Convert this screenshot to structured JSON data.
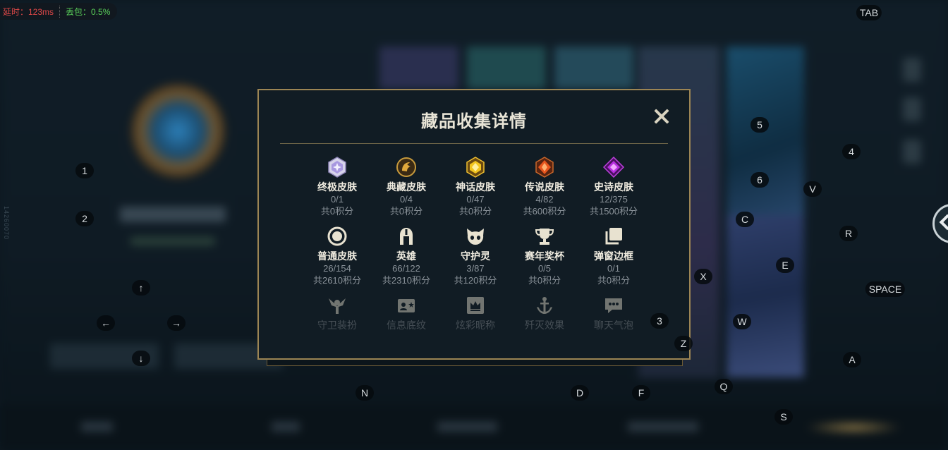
{
  "network": {
    "latency": "延时：123ms",
    "packet_loss": "丢包：0.5%"
  },
  "side_id": "14260070",
  "key_hints": [
    {
      "key": "TAB"
    },
    {
      "key": "1"
    },
    {
      "key": "2"
    },
    {
      "key": "3"
    },
    {
      "key": "4"
    },
    {
      "key": "5"
    },
    {
      "key": "6"
    },
    {
      "key": "V"
    },
    {
      "key": "C"
    },
    {
      "key": "R"
    },
    {
      "key": "E"
    },
    {
      "key": "X"
    },
    {
      "key": "SPACE"
    },
    {
      "key": "W"
    },
    {
      "key": "Z"
    },
    {
      "key": "A"
    },
    {
      "key": "Q"
    },
    {
      "key": "N"
    },
    {
      "key": "D"
    },
    {
      "key": "F"
    },
    {
      "key": "S"
    },
    {
      "key": "↑"
    },
    {
      "key": "←"
    },
    {
      "key": "→"
    },
    {
      "key": "↓"
    }
  ],
  "modal": {
    "title": "藏品收集详情",
    "rows": [
      [
        {
          "icon": "ultimate-skin-icon",
          "name": "终极皮肤",
          "count": "0/1",
          "points": "共0积分"
        },
        {
          "icon": "classic-skin-icon",
          "name": "典藏皮肤",
          "count": "0/4",
          "points": "共0积分"
        },
        {
          "icon": "mythic-skin-icon",
          "name": "神话皮肤",
          "count": "0/47",
          "points": "共0积分"
        },
        {
          "icon": "legendary-skin-icon",
          "name": "传说皮肤",
          "count": "4/82",
          "points": "共600积分"
        },
        {
          "icon": "epic-skin-icon",
          "name": "史诗皮肤",
          "count": "12/375",
          "points": "共1500积分"
        }
      ],
      [
        {
          "icon": "normal-skin-icon",
          "name": "普通皮肤",
          "count": "26/154",
          "points": "共2610积分"
        },
        {
          "icon": "champion-helmet-icon",
          "name": "英雄",
          "count": "66/122",
          "points": "共2310积分"
        },
        {
          "icon": "guardian-spirit-icon",
          "name": "守护灵",
          "count": "3/87",
          "points": "共120积分"
        },
        {
          "icon": "trophy-icon",
          "name": "赛年奖杯",
          "count": "0/5",
          "points": "共0积分"
        },
        {
          "icon": "popup-frame-icon",
          "name": "弹窗边框",
          "count": "0/1",
          "points": "共0积分"
        }
      ],
      [
        {
          "icon": "ward-skin-icon",
          "name": "守卫装扮"
        },
        {
          "icon": "info-card-icon",
          "name": "信息底纹"
        },
        {
          "icon": "colorful-name-icon",
          "name": "炫彩昵称"
        },
        {
          "icon": "kill-effect-icon",
          "name": "歼灭效果"
        },
        {
          "icon": "chat-bubble-icon",
          "name": "聊天气泡"
        }
      ]
    ]
  },
  "colors": {
    "modal_border": "#9c8554",
    "modal_bg": "#111c24",
    "latency_red": "#e04848",
    "loss_green": "#5ad05a"
  }
}
